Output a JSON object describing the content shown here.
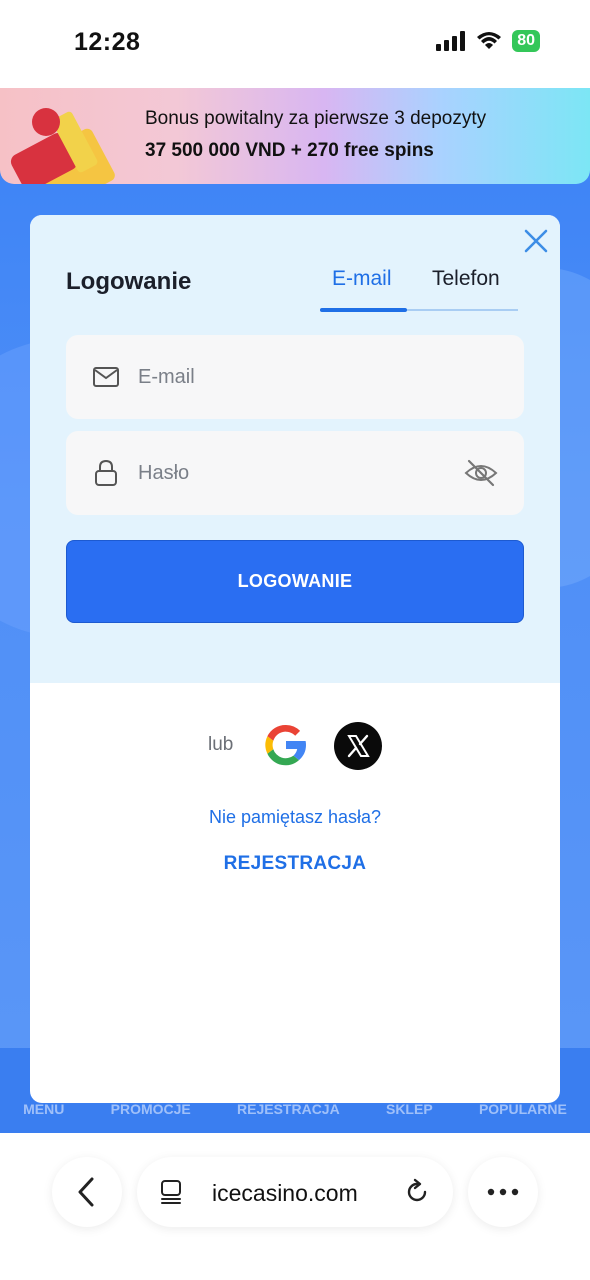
{
  "status_bar": {
    "time": "12:28",
    "battery": "80"
  },
  "promo": {
    "line1": "Bonus powitalny za pierwsze 3 depozyty",
    "line2": "37 500 000 VND + 270 free spins"
  },
  "bottom_nav": {
    "items": [
      "MENU",
      "PROMOCJE",
      "REJESTRACJA",
      "SKLEP",
      "POPULARNE"
    ]
  },
  "login_modal": {
    "title": "Logowanie",
    "tabs": [
      {
        "label": "E-mail",
        "active": true
      },
      {
        "label": "Telefon",
        "active": false
      }
    ],
    "email_field": {
      "placeholder": "E-mail",
      "value": ""
    },
    "password_field": {
      "placeholder": "Hasło",
      "value": ""
    },
    "submit_label": "LOGOWANIE",
    "or_label": "lub",
    "forgot_password": "Nie pamiętasz hasła?",
    "register": "REJESTRACJA"
  },
  "browser": {
    "url": "icecasino.com"
  },
  "colors": {
    "accent": "#2a6ef2",
    "link": "#1f6fe6",
    "modal_top": "#e3f3fd",
    "site_bg": "#3b82f6"
  },
  "icons": [
    "signal-icon",
    "wifi-icon",
    "gift-icon",
    "close-icon",
    "mail-icon",
    "lock-icon",
    "eye-off-icon",
    "google-icon",
    "x-icon",
    "back-icon",
    "tabs-icon",
    "reload-icon",
    "more-icon"
  ]
}
